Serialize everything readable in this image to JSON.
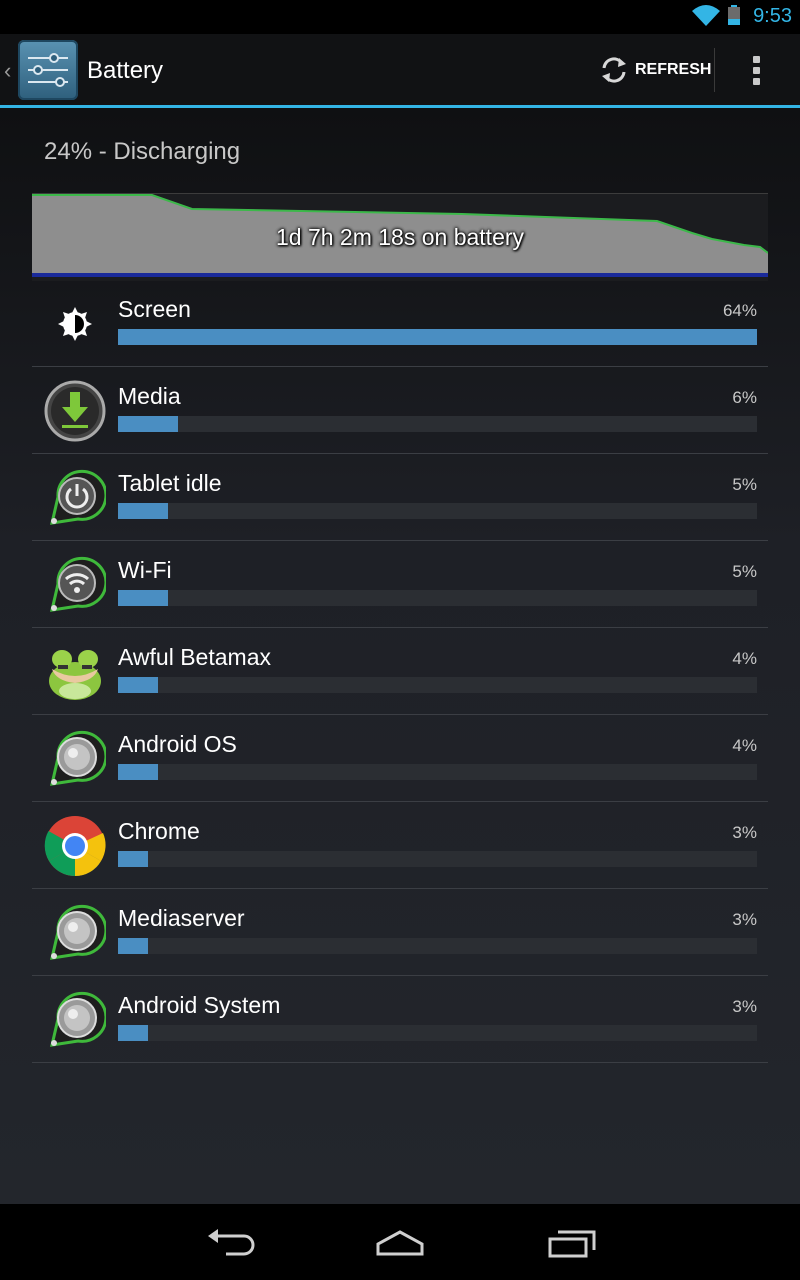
{
  "status_bar": {
    "time": "9:53",
    "accent_color": "#33b5e5"
  },
  "action_bar": {
    "title": "Battery",
    "refresh_label": "REFRESH",
    "app_icon": "settings-sliders-icon",
    "overflow_icon": "overflow-menu-icon"
  },
  "battery": {
    "status": "24% - Discharging",
    "graph_label": "1d 7h 2m 18s on battery"
  },
  "usage": [
    {
      "label": "Screen",
      "percent": "64%",
      "value": 64,
      "icon": "brightness-icon"
    },
    {
      "label": "Media",
      "percent": "6%",
      "value": 6,
      "icon": "download-icon"
    },
    {
      "label": "Tablet idle",
      "percent": "5%",
      "value": 5,
      "icon": "power-icon"
    },
    {
      "label": "Wi-Fi",
      "percent": "5%",
      "value": 5,
      "icon": "wifi-icon"
    },
    {
      "label": "Awful Betamax",
      "percent": "4%",
      "value": 4,
      "icon": "frog-app-icon"
    },
    {
      "label": "Android OS",
      "percent": "4%",
      "value": 4,
      "icon": "android-os-icon"
    },
    {
      "label": "Chrome",
      "percent": "3%",
      "value": 3,
      "icon": "chrome-icon"
    },
    {
      "label": "Mediaserver",
      "percent": "3%",
      "value": 3,
      "icon": "mediaserver-icon"
    },
    {
      "label": "Android System",
      "percent": "3%",
      "value": 3,
      "icon": "android-system-icon"
    }
  ],
  "nav_bar": {
    "back_icon": "back-icon",
    "home_icon": "home-icon",
    "recents_icon": "recents-icon"
  },
  "colors": {
    "bar_fill": "#4a8ec2",
    "bar_track": "#2b2e33"
  }
}
